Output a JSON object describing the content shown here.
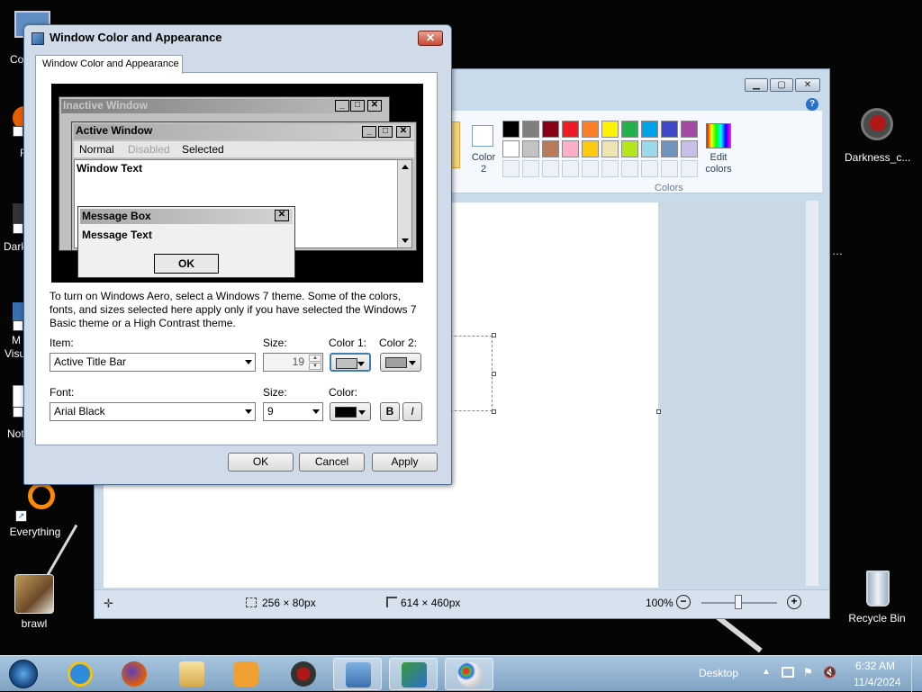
{
  "desktop": {
    "icons": [
      {
        "label": "Everything"
      },
      {
        "label": "brawl"
      },
      {
        "label": "Darkness_c..."
      },
      {
        "label": "Recycle Bin"
      }
    ],
    "edge_labels": [
      "Co",
      "F",
      "Dark",
      "M",
      "Visu",
      "Not"
    ]
  },
  "paint": {
    "color2_label": "Color\n2",
    "colors_group_label": "Colors",
    "edit_colors_label": "Edit\ncolors",
    "status": {
      "selection_size": "256 × 80px",
      "canvas_size": "614 × 460px",
      "zoom": "100%"
    },
    "palette_row1": [
      "#000000",
      "#7f7f7f",
      "#880015",
      "#ed1c24",
      "#ff7f27",
      "#fff200",
      "#22b14c",
      "#00a2e8",
      "#3f48cc",
      "#a349a4"
    ],
    "palette_row2": [
      "#ffffff",
      "#c3c3c3",
      "#b97a57",
      "#ffaec9",
      "#ffc90e",
      "#efe4b0",
      "#b5e61d",
      "#99d9ea",
      "#7092be",
      "#c8bfe7"
    ]
  },
  "dialog": {
    "title": "Window Color and Appearance",
    "tab_label": "Window Color and Appearance",
    "preview": {
      "inactive_title": "Inactive Window",
      "active_title": "Active Window",
      "menu_normal": "Normal",
      "menu_disabled": "Disabled",
      "menu_selected": "Selected",
      "window_text": "Window Text",
      "message_box_title": "Message Box",
      "message_text": "Message Text",
      "ok_label": "OK"
    },
    "info_text": "To turn on Windows Aero, select a Windows 7 theme.  Some of the colors, fonts, and sizes selected here apply only if you have selected the Windows 7 Basic theme or a High Contrast theme.",
    "item_label": "Item:",
    "item_value": "Active Title Bar",
    "size_label": "Size:",
    "size_value": "19",
    "color1_label": "Color 1:",
    "color2_label": "Color 2:",
    "color1_value": "#c0c0c0",
    "color2_value": "#a0a0a0",
    "font_label": "Font:",
    "font_value": "Arial Black",
    "font_size_label": "Size:",
    "font_size_value": "9",
    "font_color_label": "Color:",
    "font_color_value": "#000000",
    "bold_label": "B",
    "italic_label": "I",
    "ok_button": "OK",
    "cancel_button": "Cancel",
    "apply_button": "Apply"
  },
  "taskbar": {
    "desktop_label": "Desktop",
    "time": "6:32 AM",
    "date": "11/4/2024"
  }
}
